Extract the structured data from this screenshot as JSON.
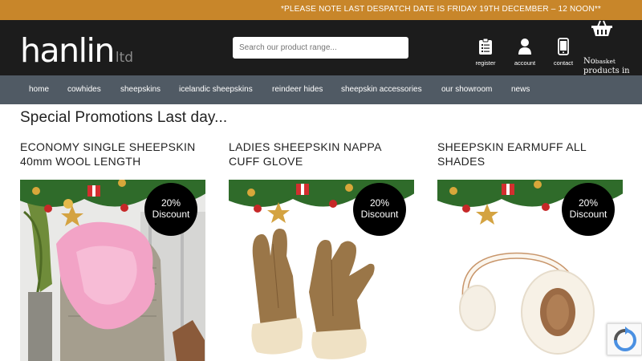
{
  "banner": {
    "text": "*PLEASE NOTE LAST DESPATCH DATE IS FRIDAY 19TH DECEMBER – 12 NOON**"
  },
  "logo": {
    "main": "hanlin",
    "sub": "ltd"
  },
  "search": {
    "placeholder": "Search our product range..."
  },
  "header_links": [
    {
      "label": "register",
      "icon": "clipboard-icon"
    },
    {
      "label": "account",
      "icon": "user-icon"
    },
    {
      "label": "contact",
      "icon": "phone-icon"
    }
  ],
  "basket": {
    "icon": "basket-icon",
    "text_prefix": "No",
    "text_small": "basket",
    "text_rest": "products in the basket."
  },
  "nav": [
    "home",
    "cowhides",
    "sheepskins",
    "icelandic sheepskins",
    "reindeer hides",
    "sheepskin accessories",
    "our showroom",
    "news"
  ],
  "section": {
    "title": "Special Promotions  Last day..."
  },
  "products": [
    {
      "title": "ECONOMY SINGLE SHEEPSKIN 40mm WOOL LENGTH",
      "badge": "20% Discount"
    },
    {
      "title": "LADIES SHEEPSKIN NAPPA CUFF GLOVE",
      "badge": "20% Discount"
    },
    {
      "title": "SHEEPSKIN EARMUFF ALL SHADES",
      "badge": "20% Discount"
    }
  ],
  "colors": {
    "banner": "#c8862a",
    "header": "#1c1c1c",
    "nav": "#505a64"
  }
}
